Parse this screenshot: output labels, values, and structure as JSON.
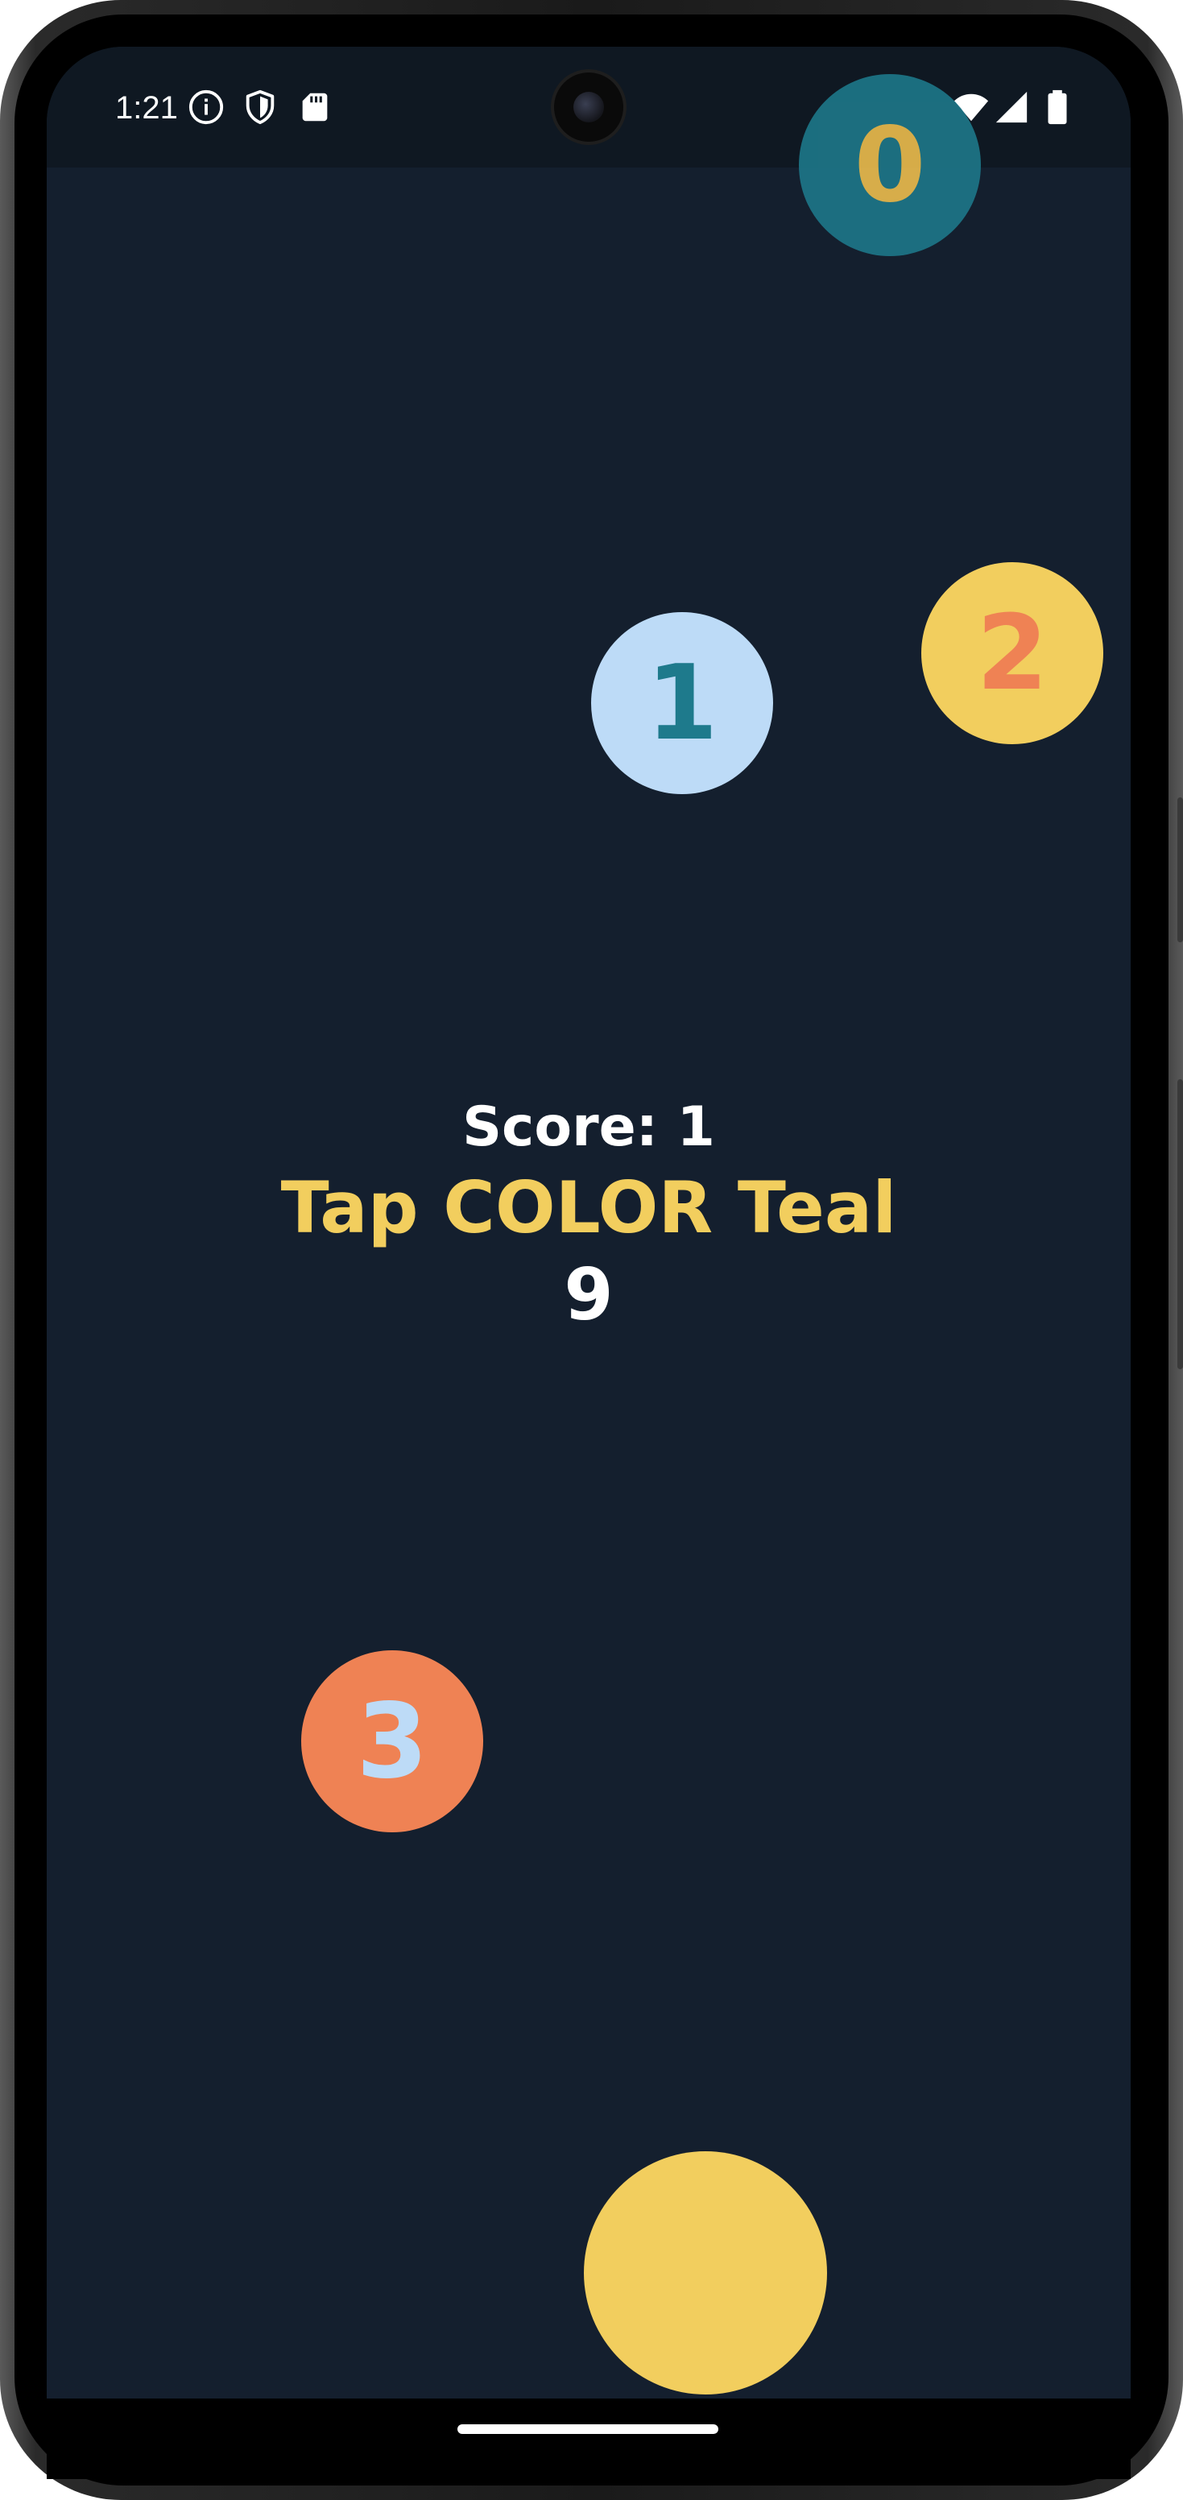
{
  "status_bar": {
    "time": "1:21",
    "left_icons": [
      "info-icon",
      "shield-icon",
      "sd-card-icon"
    ],
    "right_icons": [
      "wifi-icon",
      "signal-icon",
      "battery-icon"
    ]
  },
  "bubbles": [
    {
      "label": "0",
      "fill": "#1e7a8c",
      "text_color": "#f2c14e"
    },
    {
      "label": "1",
      "fill": "#bddbf7",
      "text_color": "#1e7a8c"
    },
    {
      "label": "2",
      "fill": "#f2ce5e",
      "text_color": "#ef8254"
    },
    {
      "label": "3",
      "fill": "#ef8254",
      "text_color": "#bddbf7"
    }
  ],
  "player_ball": {
    "fill": "#f2ce5e"
  },
  "hud": {
    "score_text": "Score: 1",
    "instruction": "Tap COLOR Teal",
    "timer": "9"
  },
  "colors": {
    "background": "#141f2e",
    "status_bar": "#0f1822",
    "instruction_color": "#f2ce5e",
    "score_color": "#ffffff"
  }
}
